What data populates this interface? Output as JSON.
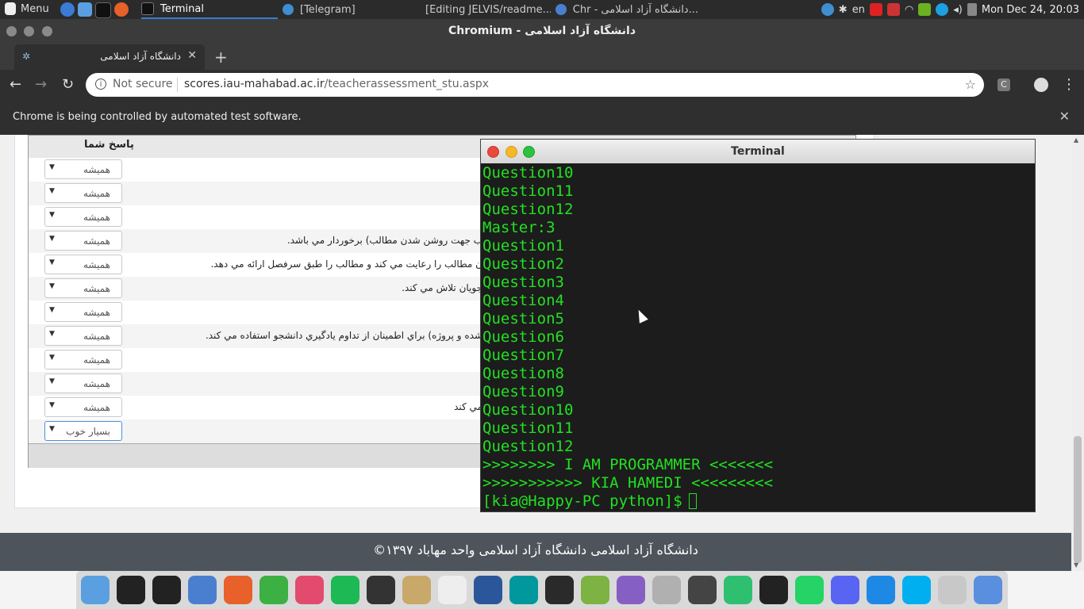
{
  "system_panel": {
    "menu_label": "Menu",
    "tasks": [
      {
        "label": "Terminal",
        "active": true
      },
      {
        "label": "[Telegram]",
        "active": false
      },
      {
        "label": "[Editing JELVIS/readme....",
        "active": false
      },
      {
        "label": "Chr - دانشگاه آزاد اسلامی...",
        "active": false
      }
    ],
    "keyboard_layout": "en",
    "clock": "Mon Dec 24, 20:03"
  },
  "browser": {
    "window_title": "Chromium - دانشگاه آزاد اسلامی",
    "tab_title": "دانشگاه آزاد اسلامی",
    "security_label": "Not secure",
    "url_host": "scores.iau-mahabad.ac.ir",
    "url_path": "/teacherassessment_stu.aspx",
    "extension_letter": "C",
    "infobar_message": "Chrome is being controlled by automated test software."
  },
  "page": {
    "answer_column_header": "پاسخ شما",
    "rows": [
      {
        "answer": "هميشه",
        "question": ""
      },
      {
        "answer": "هميشه",
        "question": ""
      },
      {
        "answer": "هميشه",
        "question": ""
      },
      {
        "answer": "هميشه",
        "question": "ب جهت روشن شدن مطالب) برخوردار مي باشد."
      },
      {
        "answer": "هميشه",
        "question": "ن مطالب را رعايت مي كند و مطالب را طبق سرفصل ارائه مي دهد."
      },
      {
        "answer": "هميشه",
        "question": "جويان تلاش مي كند."
      },
      {
        "answer": "هميشه",
        "question": ""
      },
      {
        "answer": "هميشه",
        "question": "شده و پروژه) براي اطمينان از تداوم يادگيري دانشجو استفاده مي كند."
      },
      {
        "answer": "هميشه",
        "question": ""
      },
      {
        "answer": "هميشه",
        "question": ""
      },
      {
        "answer": "هميشه",
        "question": "مي كند"
      },
      {
        "answer": "بسيار خوب",
        "question": ""
      }
    ],
    "footer_text": "©۱۳۹۷ دانشگاه آزاد اسلامی دانشگاه آزاد اسلامی واحد مهاباد"
  },
  "terminal": {
    "title": "Terminal",
    "lines": [
      "Question10",
      "Question11",
      "Question12",
      "Master:3",
      "Question1",
      "Question2",
      "Question3",
      "Question4",
      "Question5",
      "Question6",
      "Question7",
      "Question8",
      "Question9",
      "Question10",
      "Question11",
      "Question12",
      ">>>>>>>> I AM PROGRAMMER <<<<<<<",
      ">>>>>>>>>>> KIA HAMEDI <<<<<<<<<"
    ],
    "prompt": "[kia@Happy-PC python]$"
  },
  "colors": {
    "terminal_text": "#22e022",
    "footer_bg": "#4d545b",
    "focus_ring": "#4a8fe0"
  },
  "dock": {
    "apps": [
      "finder-icon",
      "terminal-icon",
      "terminal-icon",
      "chromium-icon",
      "firefox-icon",
      "facetime-icon",
      "itunes-icon",
      "spotify-icon",
      "telegram-icon",
      "calculator-icon",
      "notes-icon",
      "word-icon",
      "arduino-icon",
      "pycharm-icon",
      "android-studio-icon",
      "visual-studio-icon",
      "network-icon",
      "code-editor-icon",
      "atom-icon",
      "inkscape-icon",
      "whatsapp-icon",
      "discord-icon",
      "vpn-icon",
      "skype-icon",
      "trash-icon",
      "chrome-icon"
    ]
  }
}
